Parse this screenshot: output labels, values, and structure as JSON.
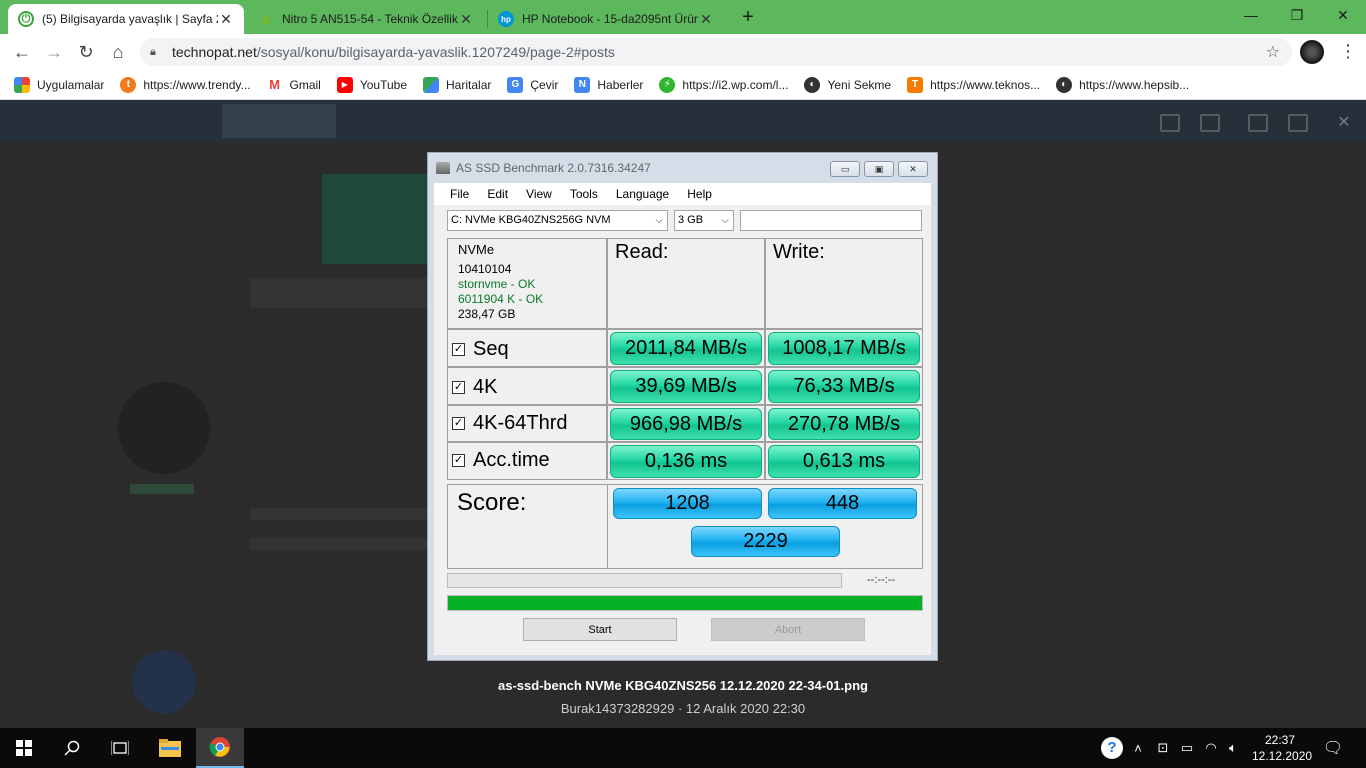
{
  "browser": {
    "tabs": [
      {
        "title": "(5) Bilgisayarda yavaşlık | Sayfa 2 |",
        "active": true
      },
      {
        "title": "Nitro 5 AN515-54 - Teknik Özellik",
        "active": false
      },
      {
        "title": "HP Notebook - 15-da2095nt Ürün",
        "active": false
      }
    ],
    "url_host": "technopat.net",
    "url_path": "/sosyal/konu/bilgisayarda-yavaslik.1207249/page-2#posts",
    "bookmarks": [
      {
        "label": "Uygulamalar",
        "icon": "apps-icon",
        "color": "#e8453c"
      },
      {
        "label": "https://www.trendy...",
        "icon": "trendyol-icon",
        "color": "#f27a1a"
      },
      {
        "label": "Gmail",
        "icon": "gmail-icon",
        "color": "#ea4335"
      },
      {
        "label": "YouTube",
        "icon": "youtube-icon",
        "color": "#ff0000"
      },
      {
        "label": "Haritalar",
        "icon": "maps-icon",
        "color": "#34a853"
      },
      {
        "label": "Çevir",
        "icon": "translate-icon",
        "color": "#4285f4"
      },
      {
        "label": "Haberler",
        "icon": "news-icon",
        "color": "#4285f4"
      },
      {
        "label": "https://i2.wp.com/l...",
        "icon": "wp-icon",
        "color": "#2fb52f"
      },
      {
        "label": "Yeni Sekme",
        "icon": "globe-icon",
        "color": "#333333"
      },
      {
        "label": "https://www.teknos...",
        "icon": "teknosa-icon",
        "color": "#f57c00"
      },
      {
        "label": "https://www.hepsib...",
        "icon": "globe-icon",
        "color": "#333333"
      }
    ]
  },
  "viewer": {
    "filename": "as-ssd-bench NVMe KBG40ZNS256 12.12.2020 22-34-01.png",
    "meta": "Burak14373282929 · 12 Aralık 2020 22:30"
  },
  "asssd": {
    "title": "AS SSD Benchmark 2.0.7316.34247",
    "menu": [
      "File",
      "Edit",
      "View",
      "Tools",
      "Language",
      "Help"
    ],
    "drive_select": "C: NVMe KBG40ZNS256G NVM",
    "size_select": "3 GB",
    "info": {
      "line1": "NVMe",
      "line2": "10410104",
      "line3": "stornvme - OK",
      "line4": "6011904 K - OK",
      "line5": "238,47 GB"
    },
    "read_header": "Read:",
    "write_header": "Write:",
    "rows": [
      {
        "label": "Seq",
        "read": "2011,84 MB/s",
        "write": "1008,17 MB/s"
      },
      {
        "label": "4K",
        "read": "39,69 MB/s",
        "write": "76,33 MB/s"
      },
      {
        "label": "4K-64Thrd",
        "read": "966,98 MB/s",
        "write": "270,78 MB/s"
      },
      {
        "label": "Acc.time",
        "read": "0,136 ms",
        "write": "0,613 ms"
      }
    ],
    "score_label": "Score:",
    "score_read": "1208",
    "score_write": "448",
    "score_total": "2229",
    "time_label": "--:--:--",
    "progress_fraction": 1.0,
    "start_label": "Start",
    "abort_label": "Abort",
    "ok_color": "#0b7a2a"
  },
  "taskbar": {
    "time": "22:37",
    "date": "12.12.2020"
  }
}
